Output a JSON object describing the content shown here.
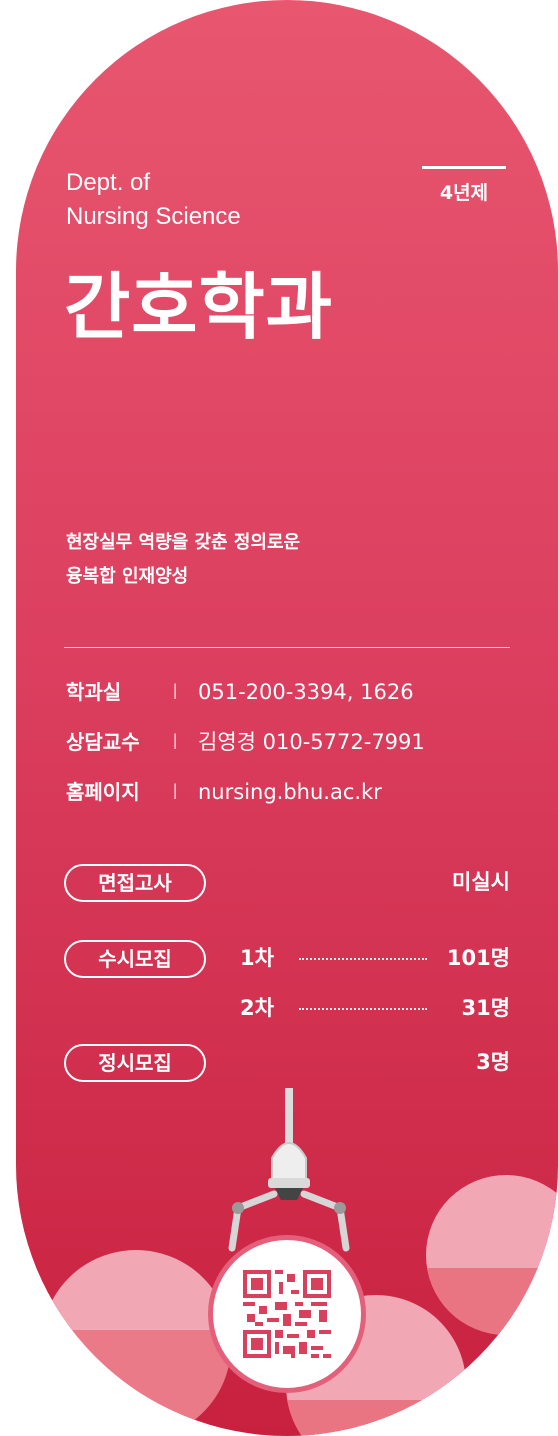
{
  "dept_en": [
    "Dept. of",
    "Nursing Science"
  ],
  "years": "4년제",
  "title": "간호학과",
  "slogan": [
    "현장실무 역량을 갖춘 정의로운",
    "융복합 인재양성"
  ],
  "contact": [
    {
      "label": "학과실",
      "sep": "I",
      "value": "051-200-3394, 1626"
    },
    {
      "label": "상담교수",
      "sep": "I",
      "value": "김영경 010-5772-7991"
    },
    {
      "label": "홈페이지",
      "sep": "I",
      "value": "nursing.bhu.ac.kr"
    }
  ],
  "admission": {
    "interview": {
      "label": "면접고사",
      "value": "미실시"
    },
    "susi": {
      "label": "수시모집",
      "round1": "1차",
      "round1_value": "101명",
      "round2": "2차",
      "round2_value": "31명"
    },
    "jeongsi": {
      "label": "정시모집",
      "value": "3명"
    }
  },
  "icons": [
    "claw-machine-icon",
    "qr-code-icon"
  ],
  "colors": {
    "top": "#e8566f",
    "bottom": "#c8213f",
    "accent_light": "#f2a7b4"
  }
}
